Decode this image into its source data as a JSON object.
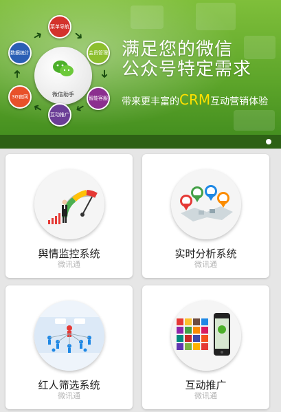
{
  "banner": {
    "headline_line1": "满足您的微信",
    "headline_line2": "公众号特定需求",
    "sub_prefix": "带来更丰富的",
    "sub_highlight": "CRM",
    "sub_suffix": "互动营销体验",
    "hub_label": "微信助手",
    "nodes": [
      {
        "label": "菜单导航",
        "color": "#d3322c"
      },
      {
        "label": "会员管理",
        "color": "#8dbf2e"
      },
      {
        "label": "智能客服",
        "color": "#8b2f8f"
      },
      {
        "label": "互动推广",
        "color": "#6b3e96"
      },
      {
        "label": "3G官网",
        "color": "#e8512a"
      },
      {
        "label": "数据统计",
        "color": "#2a5fb5"
      }
    ],
    "active_slide": 1
  },
  "cards": [
    {
      "title": "舆情监控系统",
      "subtitle": "微讯通",
      "icon": "monitoring-gauge-icon"
    },
    {
      "title": "实时分析系统",
      "subtitle": "微讯通",
      "icon": "analytics-map-icon"
    },
    {
      "title": "红人筛选系统",
      "subtitle": "微讯通",
      "icon": "people-network-icon"
    },
    {
      "title": "互动推广",
      "subtitle": "微讯通",
      "icon": "phone-apps-icon"
    }
  ]
}
